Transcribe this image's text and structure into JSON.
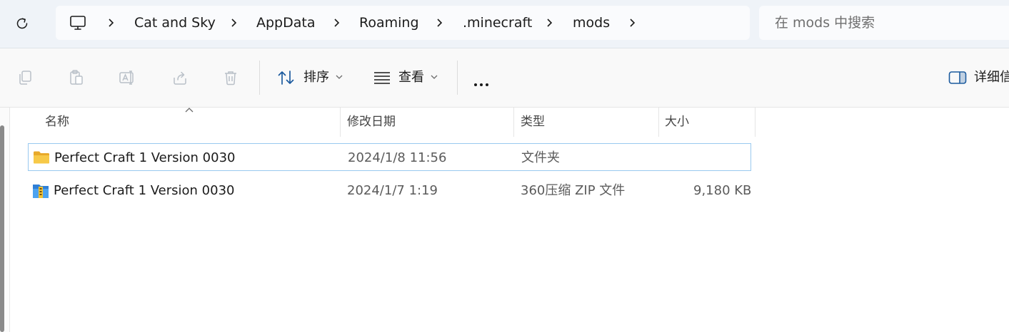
{
  "address_bar": {
    "breadcrumbs": [
      "Cat and Sky",
      "AppData",
      "Roaming",
      ".minecraft",
      "mods"
    ]
  },
  "search": {
    "placeholder": "在 mods 中搜索"
  },
  "command_bar": {
    "sort_label": "排序",
    "view_label": "查看",
    "details_label": "详细信"
  },
  "columns": {
    "name": "名称",
    "modified": "修改日期",
    "type": "类型",
    "size": "大小"
  },
  "files": [
    {
      "name": "Perfect Craft 1 Version 0030",
      "modified": "2024/1/8 11:56",
      "type": "文件夹",
      "size": "",
      "icon": "folder-icon",
      "selected": true
    },
    {
      "name": "Perfect Craft 1 Version 0030",
      "modified": "2024/1/7 1:19",
      "type": "360压缩 ZIP 文件",
      "size": "9,180 KB",
      "icon": "zip-archive-icon",
      "selected": false
    }
  ],
  "colors": {
    "folder": "#f7c948",
    "selection_border": "#99c9ef",
    "accent": "#0067c0"
  }
}
